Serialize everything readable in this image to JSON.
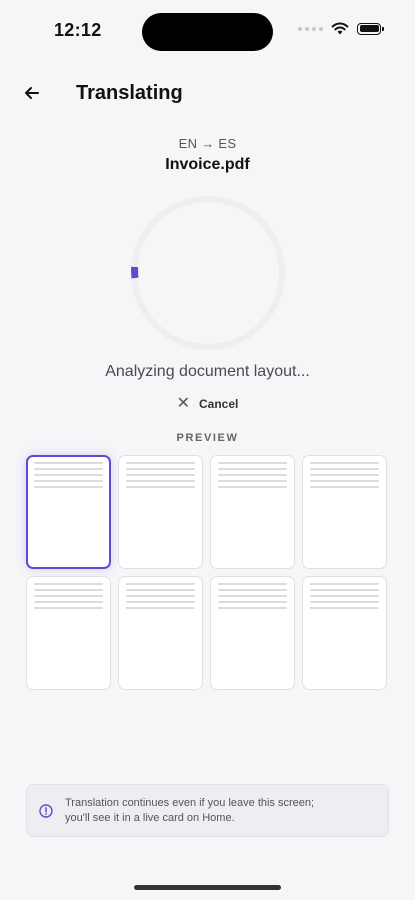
{
  "status_bar": {
    "time": "12:12"
  },
  "nav": {
    "title": "Translating",
    "back_icon": "arrow-left-icon"
  },
  "document": {
    "language_pair": "EN → ES",
    "file_name": "Invoice.pdf"
  },
  "progress": {
    "status_text": "Analyzing document layout...",
    "track_color": "#eeeef1",
    "accent_color": "#5a4ed0"
  },
  "cancel": {
    "label": "Cancel",
    "icon": "close-icon"
  },
  "preview": {
    "label": "PREVIEW",
    "selected_index": 0,
    "pages": [
      {
        "page": 1,
        "selected": true
      },
      {
        "page": 2,
        "selected": false
      },
      {
        "page": 3,
        "selected": false
      },
      {
        "page": 4,
        "selected": false
      },
      {
        "page": 5,
        "selected": false
      },
      {
        "page": 6,
        "selected": false
      },
      {
        "page": 7,
        "selected": false
      },
      {
        "page": 8,
        "selected": false
      }
    ]
  },
  "notice": {
    "icon": "info-icon",
    "text_line1": "Translation continues even if you leave this screen;",
    "text_line2": "you'll see it in a live card on Home."
  }
}
